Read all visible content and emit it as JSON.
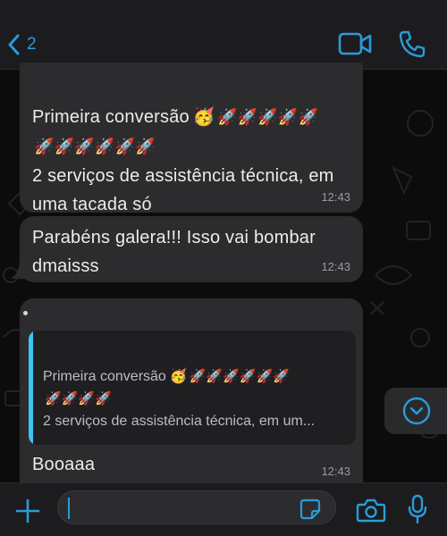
{
  "header": {
    "back_count": "2",
    "accent_color": "#2a9bd8"
  },
  "messages": [
    {
      "line1": "Primeira conversão",
      "emoji_face": "🥳",
      "rockets_line1": "🚀🚀🚀🚀🚀",
      "rockets_line2": "🚀🚀🚀🚀🚀🚀",
      "body": "2 serviços de assistência técnica, em uma tacada só",
      "time": "12:43"
    },
    {
      "body": "Parabéns galera!!! Isso vai bombar dmaisss",
      "time": "12:43"
    },
    {
      "quote": {
        "line1": "Primeira conversão",
        "emoji_face": "🥳",
        "rockets_line1": "🚀🚀🚀🚀🚀🚀",
        "rockets_line2": "🚀🚀🚀🚀",
        "line3": "2 serviços de assistência técnica, em um..."
      },
      "body": "Booaaa",
      "time": "12:43"
    }
  ],
  "input": {
    "value": "",
    "placeholder": ""
  },
  "icons": [
    "chevron-left-icon",
    "video-camera-icon",
    "phone-icon",
    "chevron-down-icon",
    "plus-icon",
    "sticker-icon",
    "camera-icon",
    "microphone-icon"
  ]
}
